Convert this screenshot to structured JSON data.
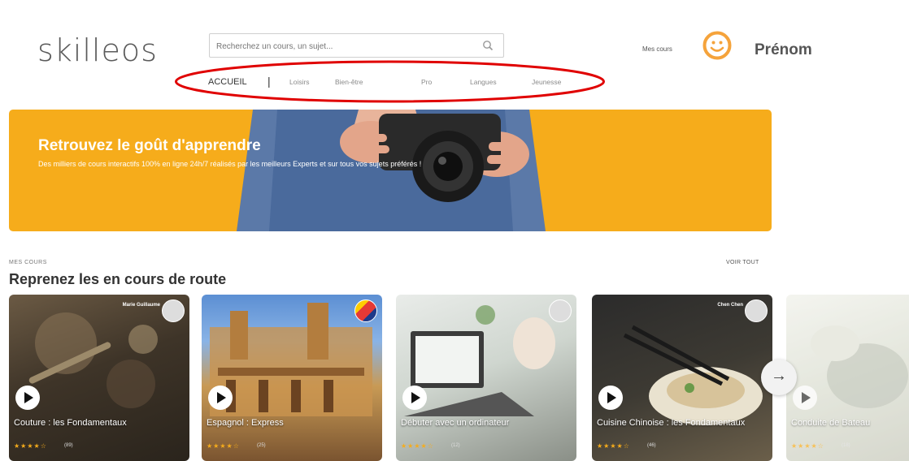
{
  "header": {
    "logo": "skilleos",
    "search_placeholder": "Recherchez un cours, un sujet...",
    "my_courses": "Mes cours",
    "username": "Prénom"
  },
  "nav": {
    "active": "ACCUEIL",
    "separator": "|",
    "items": [
      "Loisirs",
      "Bien-être",
      "Pro",
      "Langues",
      "Jeunesse"
    ]
  },
  "banner": {
    "title": "Retrouvez le goût d'apprendre",
    "subtitle": "Des milliers de cours interactifs 100% en ligne 24h/7 réalisés par les meilleurs Experts et sur tous vos sujets préférés !"
  },
  "section": {
    "label": "MES COURS",
    "see_all": "VOIR TOUT",
    "title": "Reprenez les en cours de route"
  },
  "cards": [
    {
      "title": "Couture : les Fondamentaux",
      "stars": "★★★★☆",
      "reviews": "(89)",
      "author": "Marie Guillaume"
    },
    {
      "title": "Espagnol : Express",
      "stars": "★★★★☆",
      "reviews": "(25)",
      "author": ""
    },
    {
      "title": "Débuter avec un ordinateur",
      "stars": "★★★★☆",
      "reviews": "(12)",
      "author": ""
    },
    {
      "title": "Cuisine Chinoise : les Fondamentaux",
      "stars": "★★★★☆",
      "reviews": "(46)",
      "author": "Chen Chen"
    },
    {
      "title": "Conduite de Bateau",
      "stars": "★★★★☆",
      "reviews": "(18)",
      "author": ""
    }
  ],
  "colors": {
    "accent": "#f6ac1b",
    "highlight": "#e00000"
  },
  "icons": {
    "search": "search-icon",
    "avatar": "smiley-icon",
    "play": "play-icon",
    "next": "arrow-right-icon"
  }
}
